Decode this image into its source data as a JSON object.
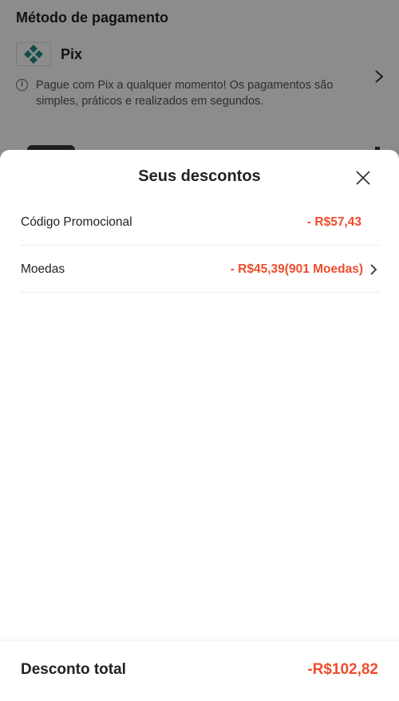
{
  "background": {
    "section_title": "Método de pagamento",
    "payment_method": {
      "name": "Pix",
      "info": "Pague com Pix a qualquer momento! Os pagamentos são simples, práticos e realizados em segundos.",
      "icon": "pix-logo-icon"
    }
  },
  "sheet": {
    "title": "Seus descontos",
    "close_icon": "close-icon",
    "rows": [
      {
        "label": "Código Promocional",
        "value": "- R$57,43"
      },
      {
        "label": "Moedas",
        "value": "- R$45,39(901 Moedas)",
        "icon": "chevron-right-icon"
      }
    ],
    "total": {
      "label": "Desconto total",
      "value": "-R$102,82"
    }
  },
  "colors": {
    "accent": "#ee4d2d",
    "pix": "#32bcad"
  }
}
